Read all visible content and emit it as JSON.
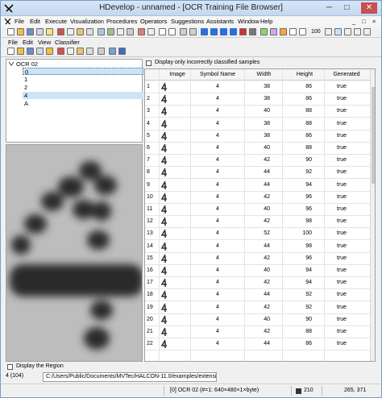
{
  "window": {
    "title": "HDevelop - unnamed - [OCR Training File Browser]",
    "minimize": "─",
    "maximize": "□",
    "close": "✕"
  },
  "menubar": [
    "File",
    "Edit",
    "Execute",
    "Visualization",
    "Procedures",
    "Operators",
    "Suggestions",
    "Assistants",
    "Window",
    "Help"
  ],
  "mdi_buttons": [
    "_",
    "□",
    "×"
  ],
  "toolbar": {
    "zoom_value": "100"
  },
  "submenu": [
    "File",
    "Edit",
    "View",
    "Classifier"
  ],
  "tree": {
    "root": "OCR 02",
    "children": [
      {
        "label": "0",
        "selected": true
      },
      {
        "label": "1",
        "selected": false
      },
      {
        "label": "2",
        "selected": false
      },
      {
        "label": "4",
        "selected": true
      },
      {
        "label": "A",
        "selected": false
      }
    ]
  },
  "display_region_label": "Display the Region",
  "incorrect_label": "Display only incorrectly classified samples",
  "grid": {
    "columns": [
      "Image",
      "Symbol Name",
      "Width",
      "Height",
      "Generated"
    ],
    "rows": [
      {
        "n": "1",
        "symbol": "4",
        "width": "38",
        "height": "86",
        "generated": "true"
      },
      {
        "n": "2",
        "symbol": "4",
        "width": "38",
        "height": "86",
        "generated": "true"
      },
      {
        "n": "3",
        "symbol": "4",
        "width": "40",
        "height": "88",
        "generated": "true"
      },
      {
        "n": "4",
        "symbol": "4",
        "width": "38",
        "height": "88",
        "generated": "true"
      },
      {
        "n": "5",
        "symbol": "4",
        "width": "38",
        "height": "86",
        "generated": "true"
      },
      {
        "n": "6",
        "symbol": "4",
        "width": "40",
        "height": "88",
        "generated": "true"
      },
      {
        "n": "7",
        "symbol": "4",
        "width": "42",
        "height": "90",
        "generated": "true"
      },
      {
        "n": "8",
        "symbol": "4",
        "width": "44",
        "height": "92",
        "generated": "true"
      },
      {
        "n": "9",
        "symbol": "4",
        "width": "44",
        "height": "94",
        "generated": "true"
      },
      {
        "n": "10",
        "symbol": "4",
        "width": "42",
        "height": "96",
        "generated": "true"
      },
      {
        "n": "11",
        "symbol": "4",
        "width": "40",
        "height": "96",
        "generated": "true"
      },
      {
        "n": "12",
        "symbol": "4",
        "width": "42",
        "height": "98",
        "generated": "true"
      },
      {
        "n": "13",
        "symbol": "4",
        "width": "52",
        "height": "100",
        "generated": "true"
      },
      {
        "n": "14",
        "symbol": "4",
        "width": "44",
        "height": "98",
        "generated": "true"
      },
      {
        "n": "15",
        "symbol": "4",
        "width": "42",
        "height": "96",
        "generated": "true"
      },
      {
        "n": "16",
        "symbol": "4",
        "width": "40",
        "height": "94",
        "generated": "true"
      },
      {
        "n": "17",
        "symbol": "4",
        "width": "42",
        "height": "94",
        "generated": "true"
      },
      {
        "n": "18",
        "symbol": "4",
        "width": "44",
        "height": "92",
        "generated": "true"
      },
      {
        "n": "19",
        "symbol": "4",
        "width": "42",
        "height": "92",
        "generated": "true"
      },
      {
        "n": "20",
        "symbol": "4",
        "width": "40",
        "height": "90",
        "generated": "true"
      },
      {
        "n": "21",
        "symbol": "4",
        "width": "42",
        "height": "88",
        "generated": "true"
      },
      {
        "n": "22",
        "symbol": "4",
        "width": "44",
        "height": "86",
        "generated": "true"
      }
    ]
  },
  "bottom": {
    "sample_info": "4 (104)",
    "path": "C:/Users/Public/Documents/MVTec/HALCON-11.0/examples/extensio"
  },
  "status": {
    "image_info": "[0] OCR 02 (#=1: 640×480×1×byte)",
    "value": "210",
    "coords": "265, 371"
  }
}
